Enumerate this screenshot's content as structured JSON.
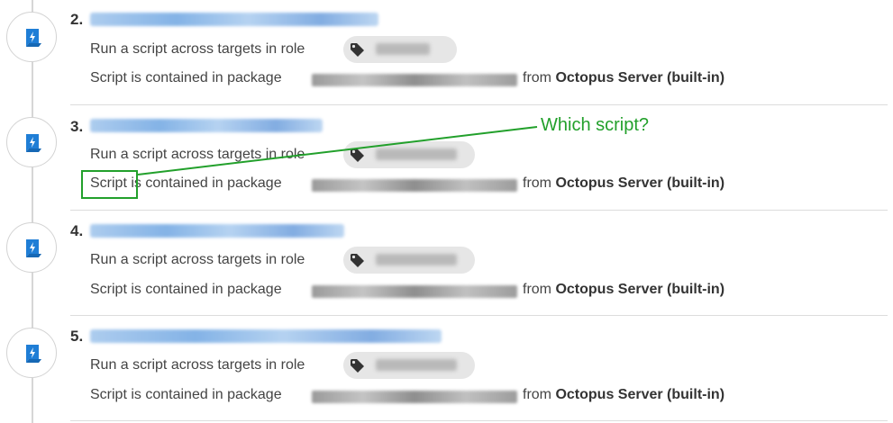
{
  "steps": [
    {
      "number": "2.",
      "run_label": "Run a script across targets in role",
      "script_word": "Script",
      "package_text": "is contained in package",
      "from_text": "from",
      "server_text": "Octopus Server (built-in)"
    },
    {
      "number": "3.",
      "run_label": "Run a script across targets in role",
      "script_word": "Script",
      "package_text": "is contained in package",
      "from_text": "from",
      "server_text": "Octopus Server (built-in)"
    },
    {
      "number": "4.",
      "run_label": "Run a script across targets in role",
      "script_word": "Script",
      "package_text": "is contained in package",
      "from_text": "from",
      "server_text": "Octopus Server (built-in)"
    },
    {
      "number": "5.",
      "run_label": "Run a script across targets in role",
      "script_word": "Script",
      "package_text": "is contained in package",
      "from_text": "from",
      "server_text": "Octopus Server (built-in)"
    }
  ],
  "annotation": {
    "text": "Which script?",
    "color": "#22a02b"
  },
  "icons": {
    "step_icon": "script-scroll-icon",
    "tag_icon": "tag-icon"
  },
  "colors": {
    "step_icon_blue": "#1f7ed6",
    "link_blue": "#6fa6e2"
  }
}
